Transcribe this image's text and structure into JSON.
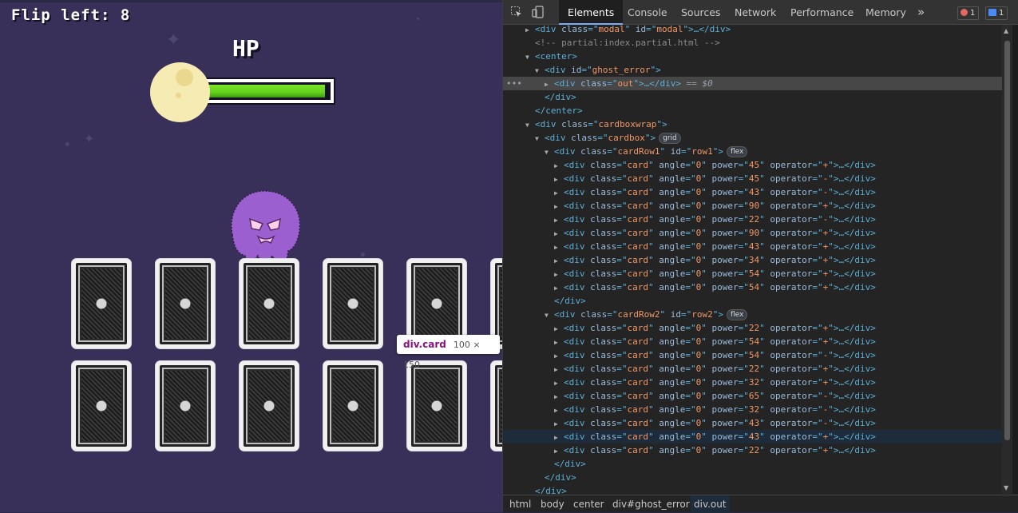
{
  "game": {
    "flip_label": "Flip left: 8",
    "hp_label": "HP",
    "hp_fraction": 0.97,
    "tooltip": {
      "tag": "div.card",
      "size": "100 × 150"
    },
    "colors": {
      "background": "#393059",
      "hp_green": "#62d21d",
      "ghost": "#9c5fd0",
      "moon": "#f6ebb2"
    }
  },
  "devtools": {
    "tabs": [
      "Elements",
      "Console",
      "Sources",
      "Network",
      "Performance",
      "Memory"
    ],
    "more_tabs": "»",
    "errors_count": "1",
    "messages_count": "1",
    "dom": {
      "l1": {
        "tag": "div",
        "a1n": "class",
        "a1v": "modal",
        "a2n": "id",
        "a2v": "modal",
        "tail": ">…</div>"
      },
      "l2": {
        "comment": "<!-- partial:index.partial.html -->"
      },
      "l3": {
        "open": "<center>"
      },
      "l4": {
        "a1n": "id",
        "a1v": "ghost_error"
      },
      "l5": {
        "a1n": "class",
        "a1v": "out",
        "tail": ">…</div>",
        "eq": " == $0"
      },
      "l6": {
        "close": "</div>"
      },
      "l7": {
        "close": "</center>"
      },
      "l8": {
        "a1n": "class",
        "a1v": "cardboxwrap"
      },
      "l9": {
        "a1n": "class",
        "a1v": "cardbox",
        "pill": "grid"
      },
      "row1": {
        "a1n": "class",
        "a1v": "cardRow1",
        "a2n": "id",
        "a2v": "row1",
        "pill": "flex"
      },
      "row2": {
        "a1n": "class",
        "a1v": "cardRow2",
        "a2n": "id",
        "a2v": "row2",
        "pill": "flex"
      },
      "close_div": "</div>",
      "card_attr": {
        "class": "card",
        "angle": "0"
      },
      "row1_cards": [
        {
          "power": "45",
          "operator": "+"
        },
        {
          "power": "45",
          "operator": "-"
        },
        {
          "power": "43",
          "operator": "-"
        },
        {
          "power": "90",
          "operator": "+"
        },
        {
          "power": "22",
          "operator": "-"
        },
        {
          "power": "90",
          "operator": "+"
        },
        {
          "power": "43",
          "operator": "+"
        },
        {
          "power": "34",
          "operator": "+"
        },
        {
          "power": "54",
          "operator": "+"
        },
        {
          "power": "54",
          "operator": "+"
        }
      ],
      "row2_cards": [
        {
          "power": "22",
          "operator": "+"
        },
        {
          "power": "54",
          "operator": "+"
        },
        {
          "power": "54",
          "operator": "-"
        },
        {
          "power": "22",
          "operator": "+"
        },
        {
          "power": "32",
          "operator": "+"
        },
        {
          "power": "65",
          "operator": "-"
        },
        {
          "power": "32",
          "operator": "-"
        },
        {
          "power": "43",
          "operator": "-"
        },
        {
          "power": "43",
          "operator": "+"
        },
        {
          "power": "22",
          "operator": "+"
        }
      ]
    },
    "breadcrumbs": [
      "html",
      "body",
      "center",
      "div#ghost_error",
      "div.out"
    ]
  }
}
